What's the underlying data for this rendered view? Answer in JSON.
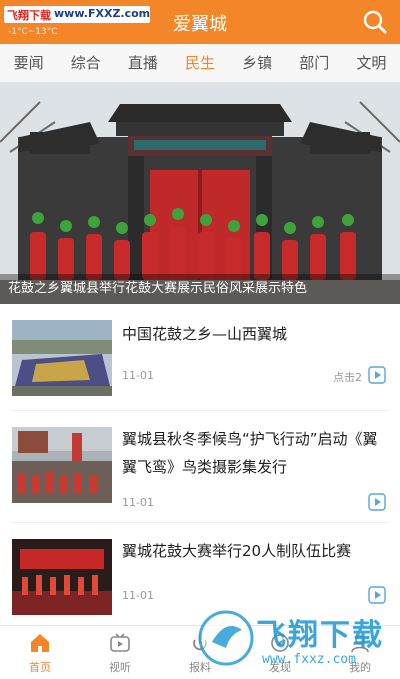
{
  "header": {
    "watermark_left": "飞翔下载",
    "watermark_right": "www.FXXZ.com",
    "weather": "-1°C~13°C",
    "title": "爱翼城",
    "search_icon": "search-icon"
  },
  "tabs": [
    {
      "label": "要闻"
    },
    {
      "label": "综合"
    },
    {
      "label": "直播"
    },
    {
      "label": "民生",
      "active": true
    },
    {
      "label": "乡镇"
    },
    {
      "label": "部门"
    },
    {
      "label": "文明"
    }
  ],
  "hero": {
    "caption": "花鼓之乡翼城县举行花鼓大赛展示民俗风采展示特色"
  },
  "news": [
    {
      "title": "中国花鼓之乡—山西翼城",
      "date": "11-01",
      "clicks": "点击2"
    },
    {
      "title": "翼城县秋冬季候鸟“护飞行动”启动《翼翼飞鸾》鸟类摄影集发行",
      "date": "11-01",
      "clicks": ""
    },
    {
      "title": "翼城花鼓大赛举行20人制队伍比赛",
      "date": "11-01",
      "clicks": ""
    }
  ],
  "bottom_nav": [
    {
      "label": "首页",
      "icon": "home-icon",
      "active": true
    },
    {
      "label": "视听",
      "icon": "tv-icon"
    },
    {
      "label": "报料",
      "icon": "report-icon"
    },
    {
      "label": "发现",
      "icon": "discover-icon"
    },
    {
      "label": "我的",
      "icon": "profile-icon"
    }
  ],
  "overlay_watermark": {
    "text": "飞翔下载",
    "url": "www.fxxz.com"
  },
  "colors": {
    "accent": "#f4862a",
    "watermark_blue": "#1996d2"
  }
}
